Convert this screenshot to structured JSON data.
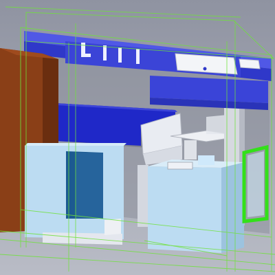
{
  "app": {
    "view_type": "3D CAD viewport"
  },
  "model": {
    "description_visible": false,
    "colors": {
      "background_top": "#8f93a1",
      "background_bottom": "#b9bcc6",
      "wireframe": "#6fe23a",
      "canopy": "#2f38c9",
      "canopy_light": "#5058e6",
      "back_panel": "#1f28c8",
      "side_panel": "#8a3f17",
      "side_panel_dark": "#6a2e0f",
      "counter": "#bcdcf2",
      "counter_dark": "#9cc3df",
      "fridge_glass": "#1c5a91",
      "door_frame": "#33e01a",
      "furniture": "#e9ecf2",
      "monitor": "#f3f5f8"
    },
    "parts": [
      "roof-canopy",
      "canopy-panel-front",
      "left-side-panel",
      "back-wall-blue",
      "left-counter",
      "display-fridge",
      "right-counter",
      "rear-pillar",
      "green-door-frame",
      "stool",
      "table",
      "monitor"
    ]
  }
}
